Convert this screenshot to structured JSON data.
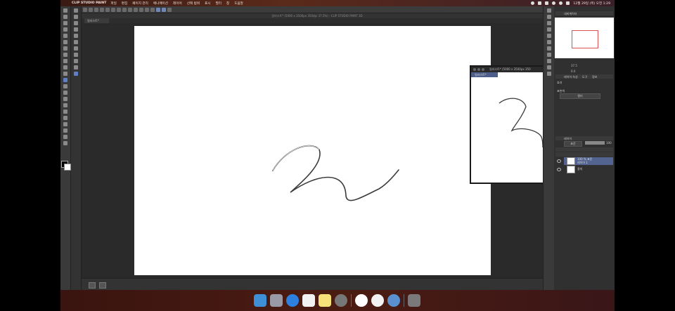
{
  "menubar": {
    "app_name": "CLIP STUDIO PAINT",
    "items": [
      "파일",
      "편집",
      "페이지 관리",
      "애니메이션",
      "레이어",
      "선택 범위",
      "표시",
      "필터",
      "창",
      "도움말"
    ],
    "clock": "12월 29일 (목) 오전 1:29"
  },
  "canvas_window": {
    "title": "일러스트* (5000 x 3500px 350dpi 37.5%) - CLIP STUDIO PAINT 3D",
    "tab_label": "일러스트*"
  },
  "sub_window": {
    "title": "일러스트* (5000 x 3500px 350",
    "tab_label": "일러스트*"
  },
  "right_panels": {
    "navigator_title": "내비게이터",
    "zoom_value": "37.5",
    "angle_value": "0.0",
    "property_tabs": [
      "레이어 속성",
      "도구",
      "정보"
    ],
    "effect_label": "효과",
    "expression_label": "표현색",
    "expression_value": "컬러",
    "layer_panel_title": "레이어",
    "blend_mode": "표준",
    "opacity": "100",
    "layers": [
      {
        "name": "100 % 표준",
        "sub": "레이어 1",
        "selected": true
      },
      {
        "name": "용지",
        "sub": "",
        "selected": false
      }
    ]
  },
  "dock": {
    "apps": [
      "finder-icon",
      "launchpad-icon",
      "safari-icon",
      "photos-icon",
      "notes-icon",
      "system-settings-icon",
      "word-icon",
      "clip-studio-icon",
      "preview-icon",
      "trash-icon"
    ]
  },
  "colors": {
    "accent": "#5f7fc5",
    "layer_selected": "#52648f",
    "navigator_frame": "#e05050"
  }
}
